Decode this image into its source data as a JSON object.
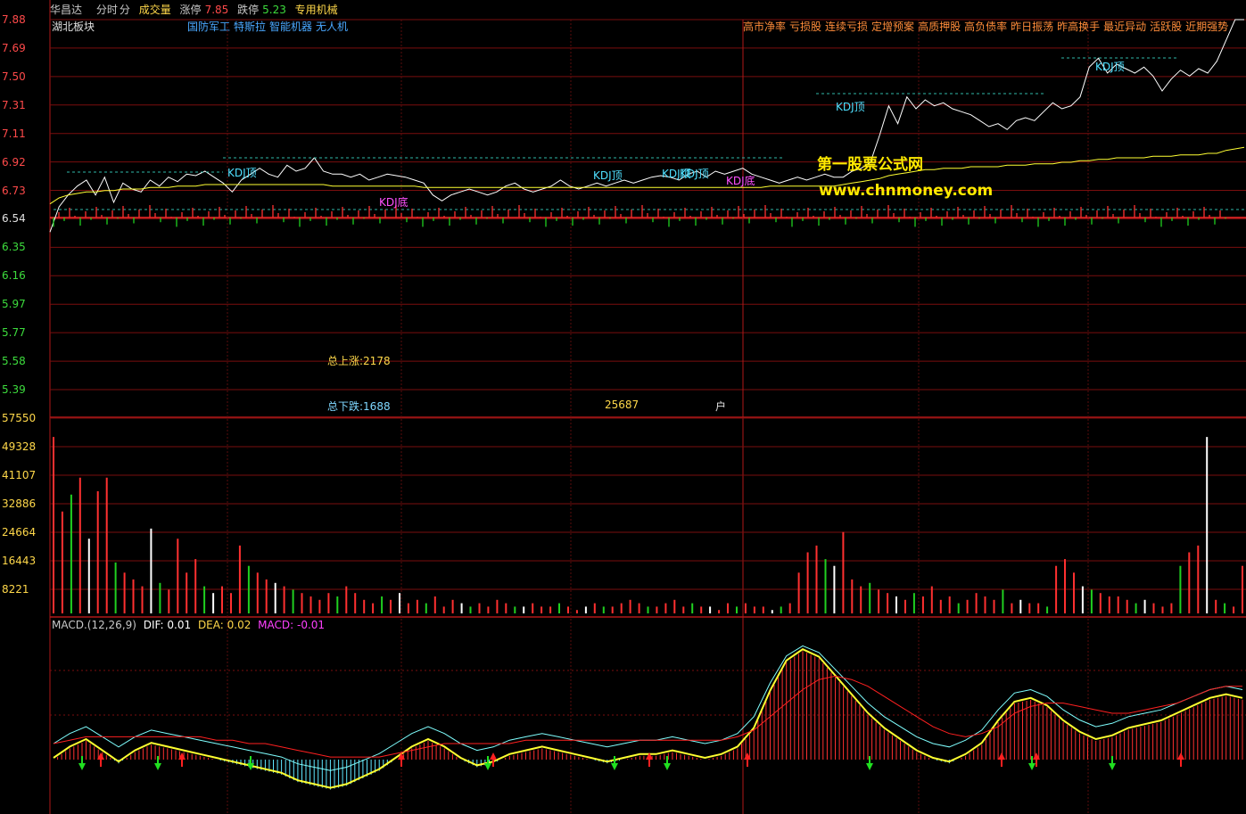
{
  "header": {
    "stock_name": "华昌达",
    "period_label": "分时",
    "minute_label": "分",
    "volume_label": "成交量",
    "limit_up_label": "涨停",
    "limit_up_value": "7.85",
    "limit_down_label": "跌停",
    "limit_down_value": "5.23",
    "industry": "专用机械",
    "colors": {
      "name": "#c8c8c8",
      "label": "#c8c8c8",
      "volume": "#ffd84a",
      "up": "#ff4a4a",
      "down": "#3ddc3d",
      "industry": "#ffd84a"
    }
  },
  "board_label": "湖北板块",
  "concept_tags": [
    "国防军工",
    "特斯拉",
    "智能机器",
    "无人机"
  ],
  "right_tags": [
    "高市净率",
    "亏损股",
    "连续亏损",
    "定增预案",
    "高质押股",
    "高负债率",
    "昨日振荡",
    "昨高换手",
    "最近异动",
    "活跃股",
    "近期强势"
  ],
  "price_axis": [
    "7.88",
    "7.69",
    "7.50",
    "7.31",
    "7.11",
    "6.92",
    "6.73",
    "6.54",
    "6.35",
    "6.16",
    "5.97",
    "5.77",
    "5.58",
    "5.39"
  ],
  "volume_axis": [
    "57550",
    "49328",
    "41107",
    "32886",
    "24664",
    "16443",
    "8221"
  ],
  "annotations": {
    "kdj_top": "KDJ顶",
    "kdj_bottom": "KDJ底",
    "kdj_overlap": "KDJ顶"
  },
  "watermark": {
    "title": "第一股票公式网",
    "url": "www.chnmoney.com"
  },
  "stats": {
    "total_up": "总上涨:2178",
    "total_down": "总下跌:1688",
    "count": "25687",
    "unit": "户"
  },
  "macd_legend": {
    "title": "MACD.(12,26,9)",
    "dif": "DIF: 0.01",
    "dea": "DEA: 0.02",
    "macd": "MACD: -0.01"
  },
  "chart_data": [
    {
      "type": "line",
      "panel": "price",
      "ylim": [
        5.39,
        7.88
      ],
      "reference_price": 6.54,
      "series": [
        {
          "name": "price",
          "color": "#ffffff",
          "values": [
            6.45,
            6.62,
            6.7,
            6.76,
            6.8,
            6.7,
            6.82,
            6.65,
            6.78,
            6.74,
            6.72,
            6.8,
            6.76,
            6.82,
            6.79,
            6.84,
            6.83,
            6.86,
            6.82,
            6.78,
            6.72,
            6.8,
            6.84,
            6.88,
            6.84,
            6.82,
            6.9,
            6.86,
            6.88,
            6.95,
            6.86,
            6.84,
            6.84,
            6.82,
            6.84,
            6.8,
            6.82,
            6.84,
            6.83,
            6.82,
            6.8,
            6.78,
            6.7,
            6.66,
            6.7,
            6.72,
            6.74,
            6.72,
            6.7,
            6.72,
            6.76,
            6.78,
            6.74,
            6.72,
            6.74,
            6.76,
            6.8,
            6.76,
            6.74,
            6.76,
            6.78,
            6.76,
            6.78,
            6.8,
            6.78,
            6.8,
            6.82,
            6.83,
            6.82,
            6.8,
            6.84,
            6.86,
            6.82,
            6.86,
            6.84,
            6.86,
            6.88,
            6.84,
            6.82,
            6.8,
            6.78,
            6.8,
            6.82,
            6.8,
            6.82,
            6.84,
            6.82,
            6.82,
            6.86,
            6.88,
            6.92,
            7.1,
            7.3,
            7.18,
            7.36,
            7.28,
            7.34,
            7.3,
            7.32,
            7.28,
            7.26,
            7.24,
            7.2,
            7.16,
            7.18,
            7.14,
            7.2,
            7.22,
            7.2,
            7.26,
            7.32,
            7.28,
            7.3,
            7.36,
            7.56,
            7.62,
            7.52,
            7.58,
            7.55,
            7.52,
            7.56,
            7.5,
            7.4,
            7.48,
            7.54,
            7.5,
            7.55,
            7.52,
            7.6,
            7.74,
            7.88,
            7.88
          ]
        },
        {
          "name": "average",
          "color": "#ffff33",
          "values": [
            6.64,
            6.68,
            6.7,
            6.71,
            6.72,
            6.72,
            6.73,
            6.73,
            6.74,
            6.74,
            6.74,
            6.75,
            6.75,
            6.75,
            6.76,
            6.76,
            6.76,
            6.77,
            6.77,
            6.77,
            6.77,
            6.77,
            6.77,
            6.77,
            6.77,
            6.77,
            6.77,
            6.77,
            6.77,
            6.77,
            6.77,
            6.76,
            6.76,
            6.76,
            6.76,
            6.76,
            6.76,
            6.76,
            6.76,
            6.76,
            6.76,
            6.75,
            6.75,
            6.75,
            6.75,
            6.75,
            6.75,
            6.75,
            6.75,
            6.75,
            6.75,
            6.75,
            6.75,
            6.75,
            6.75,
            6.75,
            6.75,
            6.75,
            6.75,
            6.75,
            6.75,
            6.75,
            6.75,
            6.75,
            6.75,
            6.75,
            6.75,
            6.75,
            6.75,
            6.75,
            6.75,
            6.75,
            6.75,
            6.75,
            6.75,
            6.75,
            6.75,
            6.75,
            6.75,
            6.76,
            6.76,
            6.76,
            6.76,
            6.76,
            6.76,
            6.76,
            6.76,
            6.77,
            6.78,
            6.79,
            6.8,
            6.81,
            6.83,
            6.84,
            6.85,
            6.86,
            6.87,
            6.87,
            6.88,
            6.88,
            6.88,
            6.89,
            6.89,
            6.89,
            6.89,
            6.9,
            6.9,
            6.9,
            6.91,
            6.91,
            6.91,
            6.92,
            6.92,
            6.93,
            6.93,
            6.94,
            6.94,
            6.95,
            6.95,
            6.95,
            6.95,
            6.96,
            6.96,
            6.96,
            6.97,
            6.97,
            6.97,
            6.98,
            6.98,
            7.0,
            7.01,
            7.02
          ]
        }
      ]
    },
    {
      "type": "bar",
      "panel": "volume",
      "ylim": [
        0,
        57550
      ],
      "values": [
        52000,
        30000,
        35000,
        40000,
        22000,
        36000,
        40000,
        15000,
        12000,
        10000,
        8000,
        25000,
        9000,
        7000,
        22000,
        12000,
        16000,
        8000,
        6000,
        8000,
        6000,
        20000,
        14000,
        12000,
        10000,
        9000,
        8000,
        7000,
        6000,
        5000,
        4000,
        6000,
        5000,
        8000,
        6000,
        4000,
        3000,
        5000,
        4000,
        6000,
        3000,
        4000,
        3000,
        5000,
        2000,
        4000,
        3000,
        2000,
        3000,
        2000,
        4000,
        3000,
        2000,
        2000,
        3000,
        2000,
        2000,
        3000,
        2000,
        1000,
        2000,
        3000,
        2000,
        2000,
        3000,
        4000,
        3000,
        2000,
        2000,
        3000,
        4000,
        2000,
        3000,
        2000,
        2000,
        1000,
        3000,
        2000,
        3000,
        2000,
        2000,
        1000,
        2000,
        3000,
        12000,
        18000,
        20000,
        16000,
        14000,
        24000,
        10000,
        8000,
        9000,
        7000,
        6000,
        5000,
        4000,
        6000,
        5000,
        8000,
        4000,
        5000,
        3000,
        4000,
        6000,
        5000,
        4000,
        7000,
        3000,
        4000,
        3000,
        3000,
        2000,
        14000,
        16000,
        12000,
        8000,
        7000,
        6000,
        5000,
        5000,
        4000,
        3000,
        4000,
        3000,
        2000,
        3000,
        14000,
        18000,
        20000,
        52000,
        4000,
        3000,
        2000,
        14000
      ]
    },
    {
      "type": "line",
      "panel": "macd",
      "series": [
        {
          "name": "DIF",
          "color": "#7fffff",
          "values": [
            0.0,
            0.03,
            0.05,
            0.02,
            -0.01,
            0.02,
            0.04,
            0.03,
            0.02,
            0.01,
            0.0,
            -0.01,
            -0.02,
            -0.03,
            -0.04,
            -0.06,
            -0.07,
            -0.08,
            -0.07,
            -0.05,
            -0.03,
            0.0,
            0.03,
            0.05,
            0.03,
            0.0,
            -0.02,
            -0.01,
            0.01,
            0.02,
            0.03,
            0.02,
            0.01,
            0.0,
            -0.01,
            0.0,
            0.01,
            0.01,
            0.02,
            0.01,
            0.0,
            0.01,
            0.03,
            0.08,
            0.18,
            0.26,
            0.29,
            0.27,
            0.22,
            0.17,
            0.12,
            0.08,
            0.05,
            0.02,
            0.0,
            -0.01,
            0.01,
            0.04,
            0.1,
            0.15,
            0.16,
            0.14,
            0.1,
            0.07,
            0.05,
            0.06,
            0.08,
            0.09,
            0.1,
            0.12,
            0.14,
            0.16,
            0.17,
            0.16
          ]
        },
        {
          "name": "DEA",
          "color": "#ff2020",
          "values": [
            0.0,
            0.01,
            0.02,
            0.02,
            0.02,
            0.02,
            0.02,
            0.02,
            0.02,
            0.02,
            0.01,
            0.01,
            0.0,
            0.0,
            -0.01,
            -0.02,
            -0.03,
            -0.04,
            -0.04,
            -0.04,
            -0.04,
            -0.03,
            -0.02,
            -0.01,
            0.0,
            0.0,
            0.0,
            0.0,
            0.0,
            0.01,
            0.01,
            0.01,
            0.01,
            0.01,
            0.01,
            0.01,
            0.01,
            0.01,
            0.01,
            0.01,
            0.01,
            0.01,
            0.02,
            0.04,
            0.08,
            0.12,
            0.16,
            0.19,
            0.2,
            0.19,
            0.17,
            0.14,
            0.11,
            0.08,
            0.05,
            0.03,
            0.02,
            0.03,
            0.05,
            0.09,
            0.11,
            0.12,
            0.12,
            0.11,
            0.1,
            0.09,
            0.09,
            0.1,
            0.11,
            0.12,
            0.14,
            0.16,
            0.17,
            0.17
          ]
        }
      ]
    }
  ]
}
